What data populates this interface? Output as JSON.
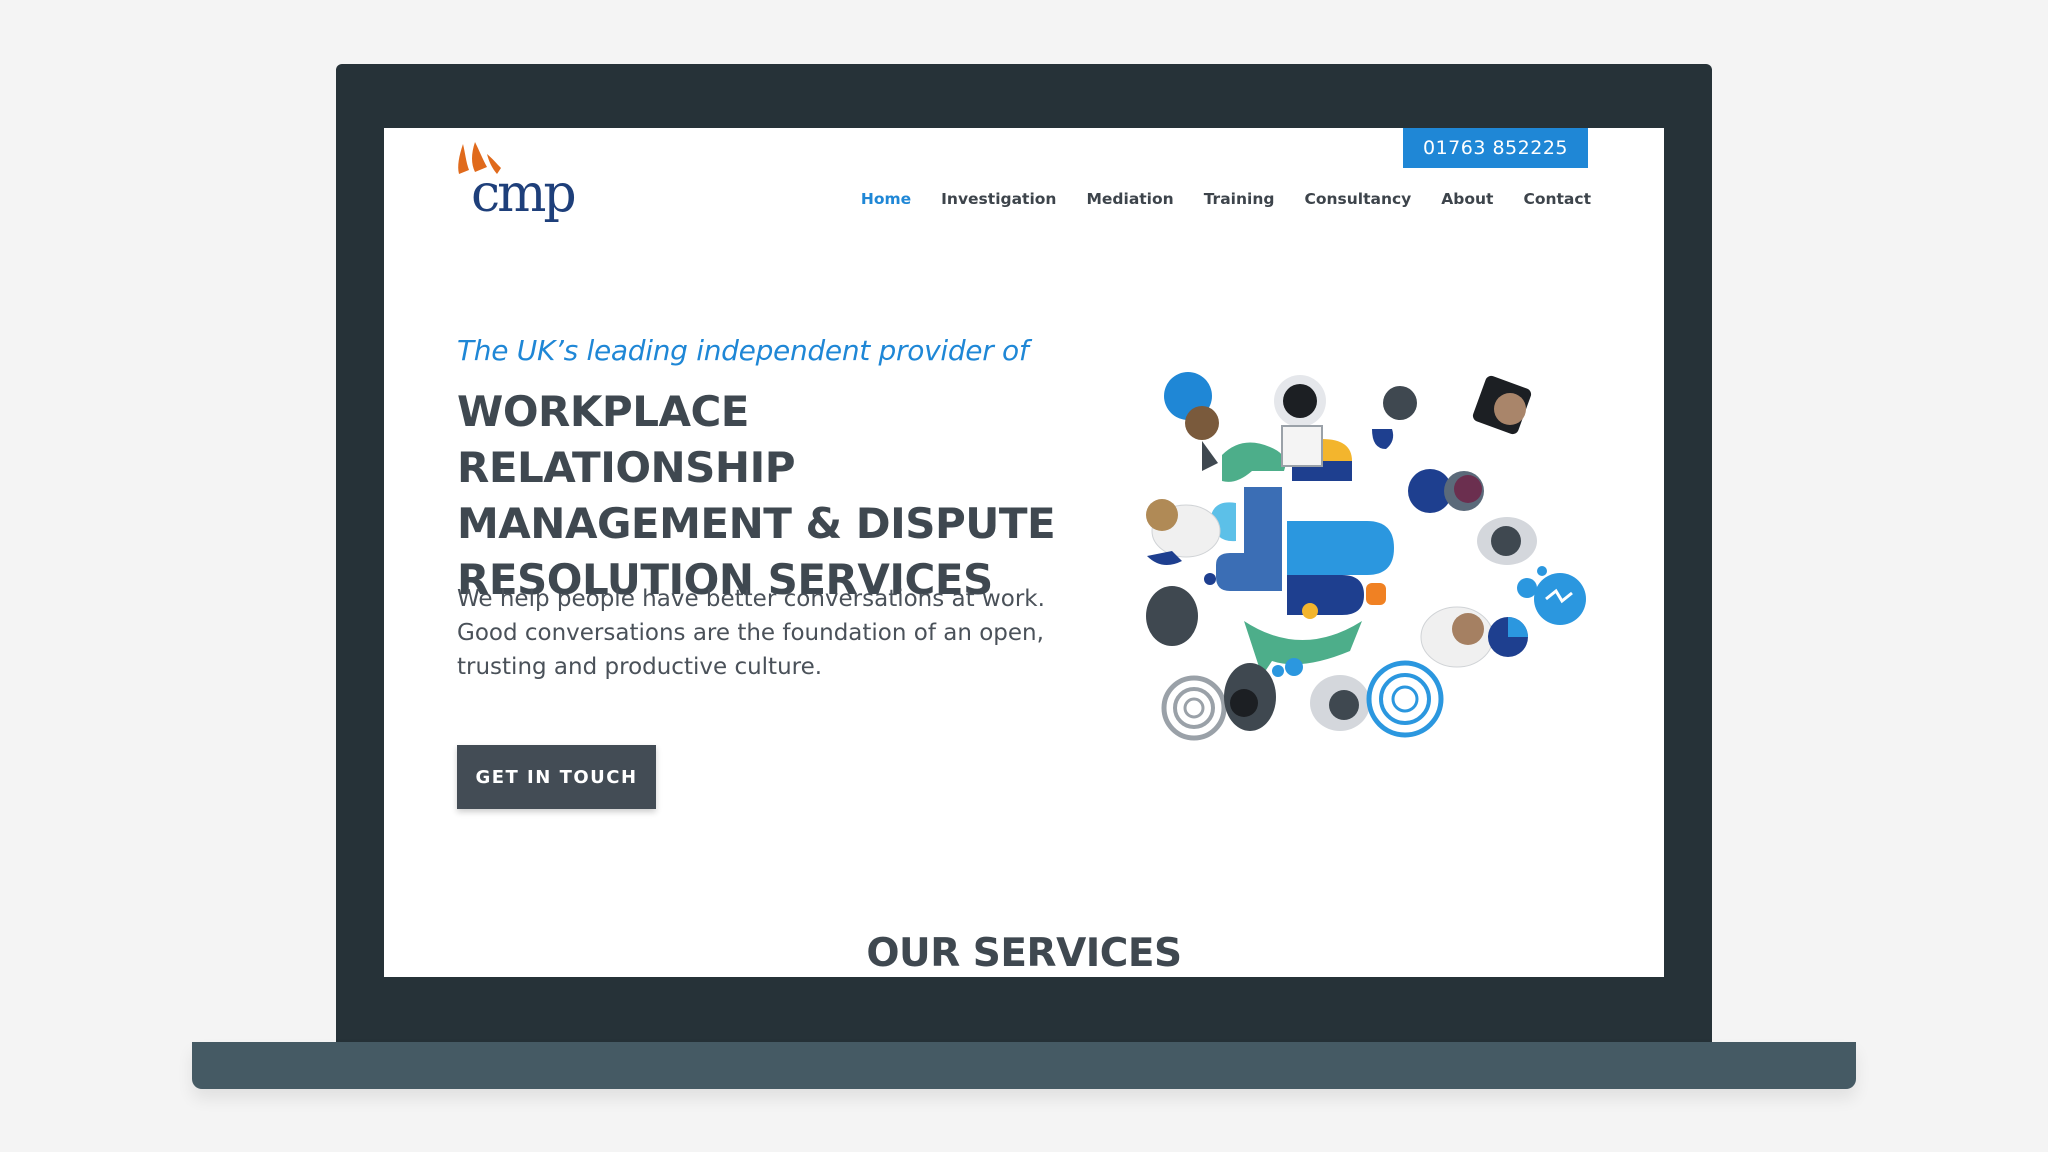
{
  "header": {
    "phone": "01763 852225",
    "logo_text": "cmp"
  },
  "nav": {
    "items": [
      "Home",
      "Investigation",
      "Mediation",
      "Training",
      "Consultancy",
      "About",
      "Contact"
    ]
  },
  "hero": {
    "tagline": "The UK’s leading independent provider of",
    "headline_lines": [
      "WORKPLACE RELATIONSHIP",
      "MANAGEMENT & DISPUTE",
      "RESOLUTION SERVICES"
    ],
    "intro_lines": [
      "We help people have better conversations at work.",
      "Good conversations are the foundation of an open,",
      "trusting and productive culture."
    ],
    "cta_label": "GET IN TOUCH"
  },
  "services": {
    "title": "OUR SERVICES"
  },
  "colors": {
    "brand_blue": "#1f87d6",
    "navy": "#1e3f7a",
    "logo_orange": "#e06a1c",
    "dark_text": "#3f4850",
    "bezel": "#263238",
    "base": "#455a64"
  },
  "icons": {
    "logo": "cmp-logo-icon",
    "illustration": "people-conversation-illustration"
  }
}
